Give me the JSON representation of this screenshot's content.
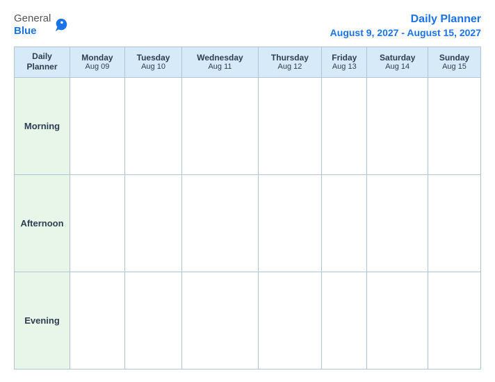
{
  "header": {
    "logo": {
      "general": "General",
      "blue": "Blue",
      "bird_symbol": "▶"
    },
    "title": "Daily Planner",
    "date_range": "August 9, 2027 - August 15, 2027"
  },
  "table": {
    "header_label_top": "Daily",
    "header_label_bottom": "Planner",
    "columns": [
      {
        "day": "Monday",
        "date": "Aug 09"
      },
      {
        "day": "Tuesday",
        "date": "Aug 10"
      },
      {
        "day": "Wednesday",
        "date": "Aug 11"
      },
      {
        "day": "Thursday",
        "date": "Aug 12"
      },
      {
        "day": "Friday",
        "date": "Aug 13"
      },
      {
        "day": "Saturday",
        "date": "Aug 14"
      },
      {
        "day": "Sunday",
        "date": "Aug 15"
      }
    ],
    "rows": [
      {
        "label": "Morning"
      },
      {
        "label": "Afternoon"
      },
      {
        "label": "Evening"
      }
    ]
  }
}
